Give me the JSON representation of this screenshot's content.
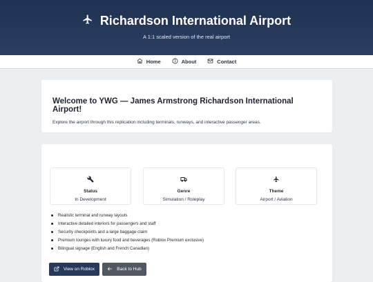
{
  "header": {
    "title": "Richardson International Airport",
    "subtitle": "A 1:1 scaled version of the real airport",
    "icon": "airplane-icon"
  },
  "nav": {
    "home": "Home",
    "about": "About",
    "contact": "Contact"
  },
  "welcome": {
    "title": "Welcome to YWG — James Armstrong Richardson International Airport!",
    "description": "Explore the airport through this replication including terminals, runways, and interactive passenger areas."
  },
  "info_cards": {
    "status": {
      "label": "Status",
      "value": "In Development",
      "icon": "wrench-icon"
    },
    "genre": {
      "label": "Genre",
      "value": "Simulation / Roleplay",
      "icon": "truck-icon"
    },
    "theme": {
      "label": "Theme",
      "value": "Airport / Aviation",
      "icon": "airplane-icon"
    }
  },
  "features": [
    "Realistic terminal and runway layouts",
    "Interactive detailed interiors for passengers and staff",
    "Security checkpoints and a large baggage claim",
    "Premium lounges with luxury food and beverages (Roblox Premium exclusive)",
    "Bilingual signage (English and French Canadian)"
  ],
  "buttons": {
    "view_on_roblox": "View on Roblox",
    "back_to_hub": "Back to Hub"
  },
  "colors": {
    "header_bg": "#1f3150",
    "primary_button": "#26395a",
    "secondary_button": "#505860",
    "page_bg": "#eceff2"
  }
}
